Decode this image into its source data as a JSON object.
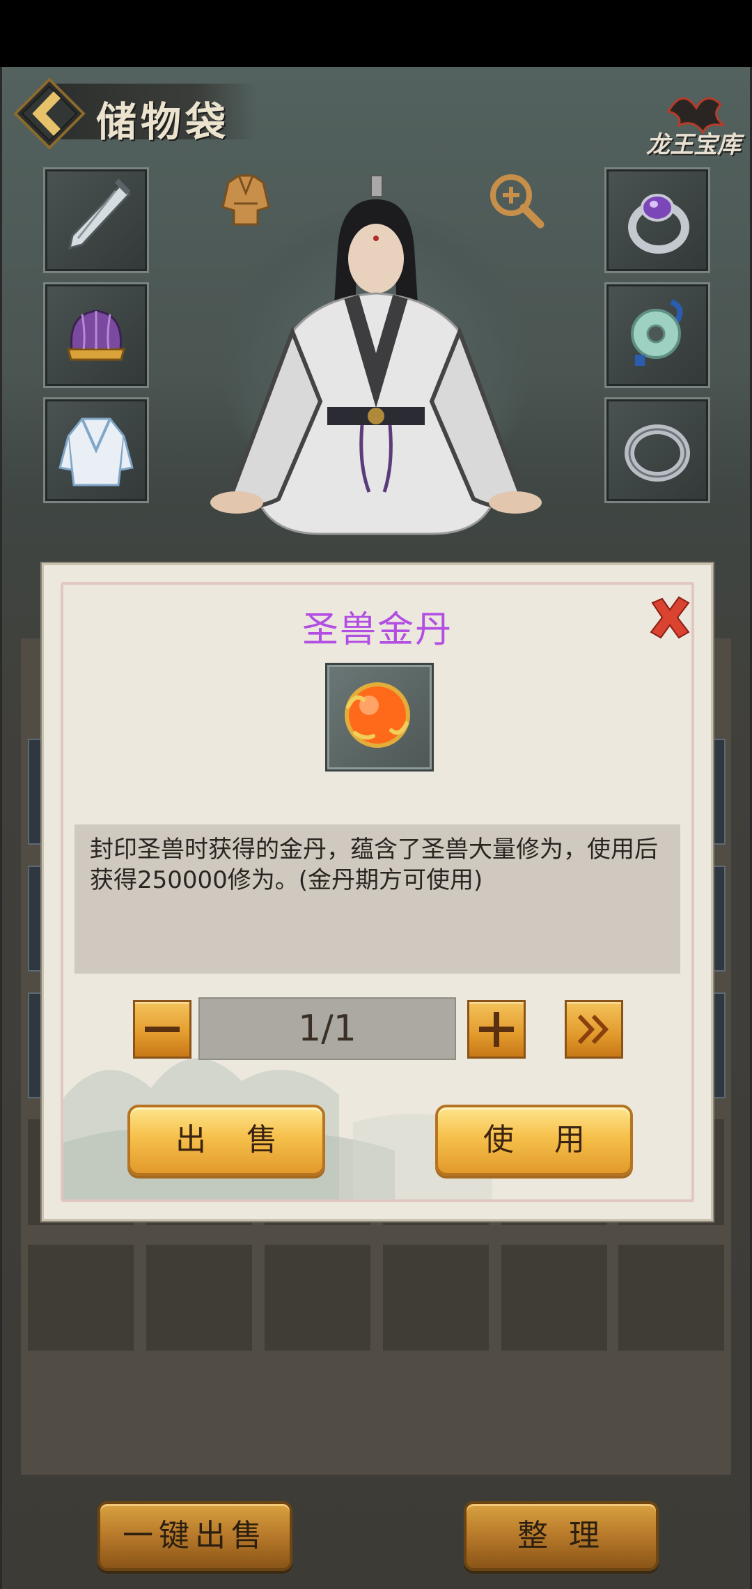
{
  "header": {
    "title": "储物袋",
    "logo_text": "龙王宝库"
  },
  "dialog": {
    "item_name": "圣兽金丹",
    "item_name_color": "#b24ee2",
    "description": "封印圣兽时获得的金丹，蕴含了圣兽大量修为，使用后获得250000修为。(金丹期方可使用)",
    "quantity": "1/1",
    "sell_label": "出 售",
    "use_label": "使 用"
  },
  "footer": {
    "quick_sell_label": "一键出售",
    "sort_label": "整 理"
  },
  "icons": {
    "back": "chevron-left-icon",
    "close": "close-x-icon",
    "zoom": "magnifier-plus-icon",
    "armor": "armor-icon",
    "minus": "minus-icon",
    "plus": "plus-icon",
    "max": "double-chevron-right-icon"
  },
  "colors": {
    "accent_gold": "#e29a2c",
    "close_red": "#d9432f"
  }
}
